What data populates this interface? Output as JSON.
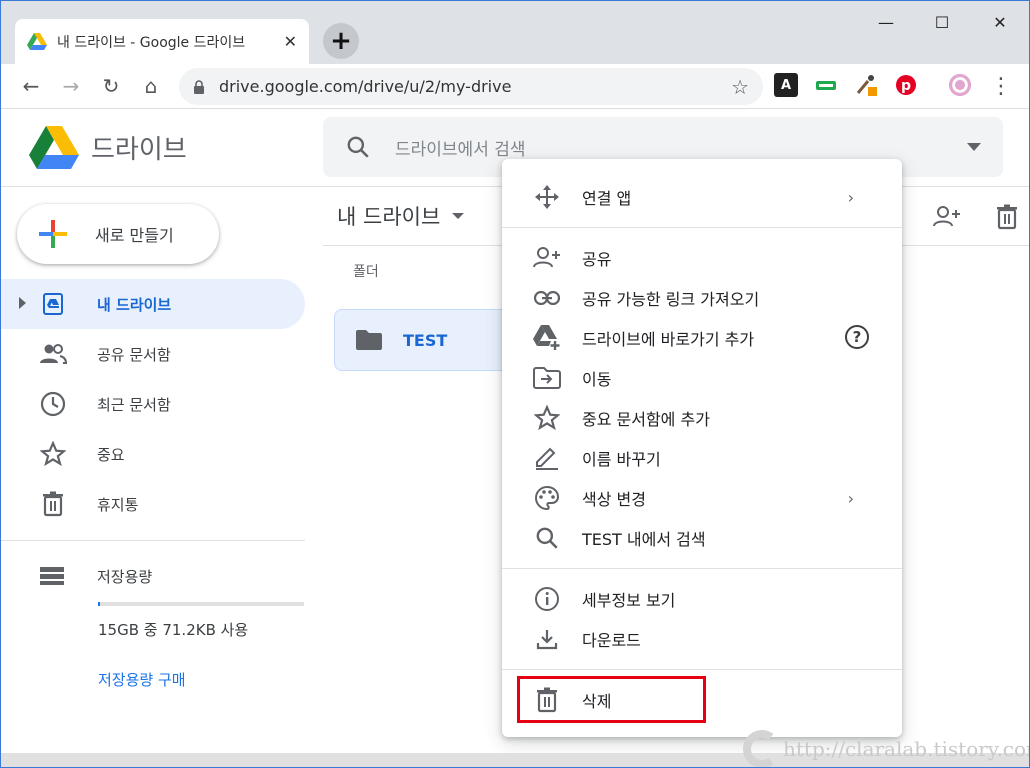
{
  "browser": {
    "tab_title": "내 드라이브 - Google 드라이브",
    "tab_close": "✕",
    "new_tab": "+",
    "minimize": "—",
    "maximize": "☐",
    "close": "✕",
    "back": "←",
    "forward": "→",
    "reload": "↻",
    "home": "⌂",
    "url": "drive.google.com/drive/u/2/my-drive",
    "bookmark_star": "☆",
    "menu_dots": "⋮"
  },
  "drive": {
    "logo_text": "드라이브",
    "search_placeholder": "드라이브에서 검색",
    "new_button": "새로 만들기",
    "nav": [
      {
        "label": "내 드라이브",
        "icon": "my-drive-icon",
        "active": true
      },
      {
        "label": "공유 문서함",
        "icon": "people-icon"
      },
      {
        "label": "최근 문서함",
        "icon": "clock-icon"
      },
      {
        "label": "중요",
        "icon": "star-icon"
      },
      {
        "label": "휴지통",
        "icon": "trash-icon"
      }
    ],
    "storage": {
      "label": "저장용량",
      "usage": "15GB 중 71.2KB 사용",
      "used_fraction": 0.001,
      "buy": "저장용량 구매"
    },
    "main_title": "내 드라이브",
    "section_label": "폴더",
    "folder_name": "TEST"
  },
  "context_menu": {
    "items": [
      {
        "label": "연결 앱",
        "icon": "move-arrows-icon",
        "submenu": true
      },
      {
        "label": "공유",
        "icon": "add-person-icon"
      },
      {
        "label": "공유 가능한 링크 가져오기",
        "icon": "link-icon"
      },
      {
        "label": "드라이브에 바로가기 추가",
        "icon": "drive-add-icon",
        "help": true
      },
      {
        "label": "이동",
        "icon": "move-to-icon"
      },
      {
        "label": "중요 문서함에 추가",
        "icon": "star-icon"
      },
      {
        "label": "이름 바꾸기",
        "icon": "pencil-icon"
      },
      {
        "label": "색상 변경",
        "icon": "palette-icon",
        "submenu": true
      },
      {
        "label": "TEST 내에서 검색",
        "icon": "search-icon"
      },
      {
        "label": "세부정보 보기",
        "icon": "info-icon"
      },
      {
        "label": "다운로드",
        "icon": "download-icon"
      },
      {
        "label": "삭제",
        "icon": "trash-icon"
      }
    ],
    "submenu_arrow": "›",
    "help_glyph": "?"
  },
  "watermark": "http://claralab.tistory.com",
  "colors": {
    "accent": "#1a73e8",
    "highlight_box": "#e60012"
  }
}
